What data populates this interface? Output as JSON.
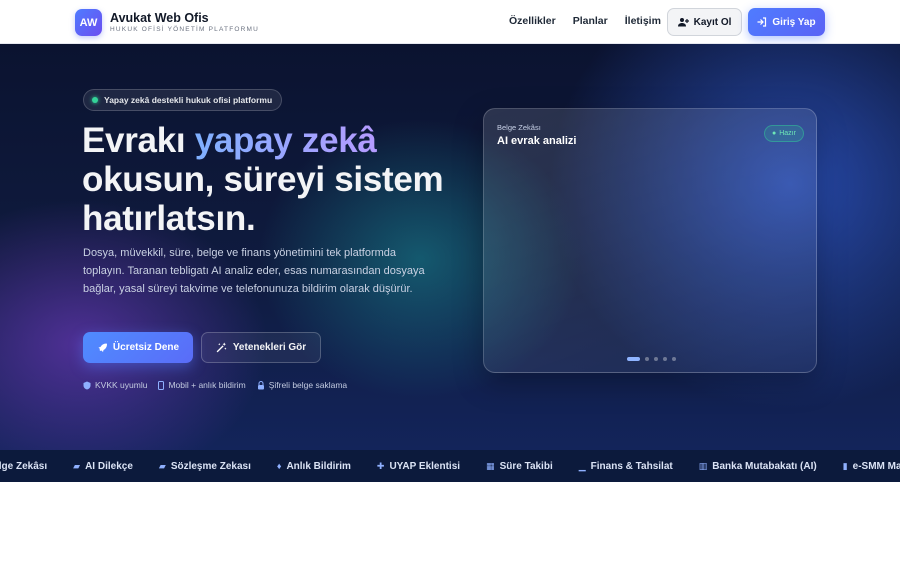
{
  "brand": {
    "logo": "AW",
    "title": "Avukat Web Ofis",
    "subtitle": "HUKUK OFİSİ YÖNETİM PLATFORMU"
  },
  "nav": {
    "items": [
      "Özellikler",
      "Planlar",
      "İletişim"
    ]
  },
  "header_buttons": {
    "register": "Kayıt Ol",
    "login": "Giriş Yap"
  },
  "hero": {
    "pill": "Yapay zekâ destekli hukuk ofisi platformu",
    "headline_pre": "Evrakı ",
    "headline_accent": "yapay zekâ",
    "headline_post": " okusun, süreyi sistem hatırlatsın.",
    "description": "Dosya, müvekkil, süre, belge ve finans yönetimini tek platformda toplayın. Taranan tebligatı AI analiz eder, esas numarasından dosyaya bağlar, yasal süreyi takvime ve telefonunuza bildirim olarak düşürür.",
    "cta_primary": "Ücretsiz Dene",
    "cta_secondary": "Yetenekleri Gör",
    "badges": [
      "KVKK uyumlu",
      "Mobil + anlık bildirim",
      "Şifreli belge saklama"
    ]
  },
  "card": {
    "label": "Belge Zekâsı",
    "title": "AI evrak analizi",
    "status": "Hazır",
    "slides": 5,
    "active_slide": 1
  },
  "marquee": {
    "items": [
      "Belge Zekâsı",
      "AI Dilekçe",
      "Sözleşme Zekası",
      "Anlık Bildirim",
      "UYAP Eklentisi",
      "Süre Takibi",
      "Finans & Tahsilat",
      "Banka Mutabakatı (AI)",
      "e-SMM Ma"
    ],
    "icons": [
      "file-icon",
      "file-pen-icon",
      "file-sign-icon",
      "bell-icon",
      "puzzle-icon",
      "calendar-icon",
      "chart-icon",
      "bank-icon",
      "receipt-icon"
    ]
  },
  "colors": {
    "accent": "#4f7cff",
    "hero_bg": "#0f1b3f",
    "status_green": "#34d399"
  }
}
